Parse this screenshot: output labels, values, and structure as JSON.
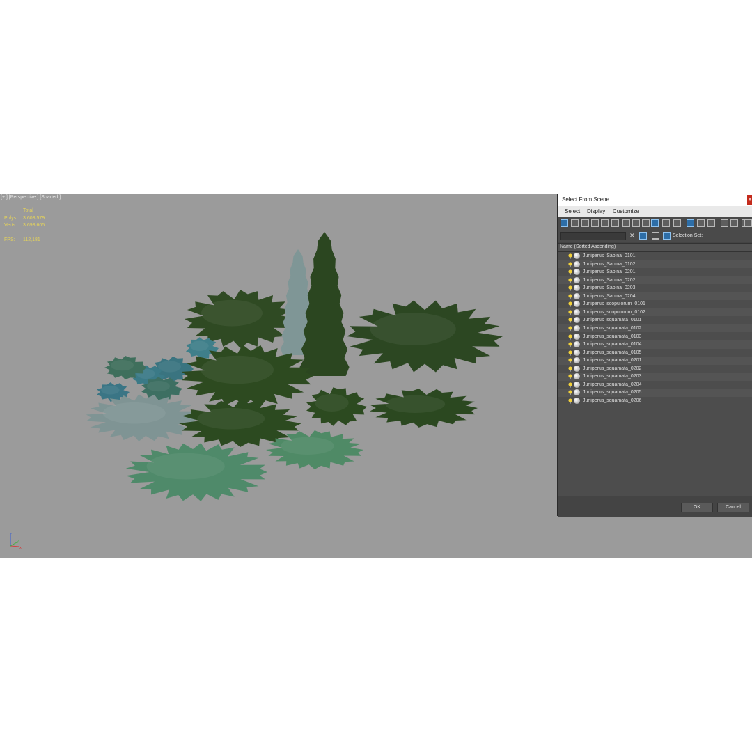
{
  "viewport": {
    "label": "[+ ] [Perspective ] [Shaded ]",
    "stats": {
      "header": "Total",
      "polys_label": "Polys:",
      "polys_value": "3 603 579",
      "verts_label": "Verts:",
      "verts_value": "3 693 605",
      "fps_label": "FPS:",
      "fps_value": "112,181"
    },
    "axis": {
      "z": "z",
      "x": "x",
      "y": "y"
    }
  },
  "dialog": {
    "title": "Select From Scene",
    "close_glyph": "×",
    "menu": [
      "Select",
      "Display",
      "Customize"
    ],
    "search_placeholder": "",
    "selection_set_label": "Selection Set:",
    "column_header": "Name (Sorted Ascending)",
    "items": [
      "Juniperus_Sabina_0101",
      "Juniperus_Sabina_0102",
      "Juniperus_Sabina_0201",
      "Juniperus_Sabina_0202",
      "Juniperus_Sabina_0203",
      "Juniperus_Sabina_0204",
      "Juniperus_scopulorum_0101",
      "Juniperus_scopulorum_0102",
      "Juniperus_squamata_0101",
      "Juniperus_squamata_0102",
      "Juniperus_squamata_0103",
      "Juniperus_squamata_0104",
      "Juniperus_squamata_0105",
      "Juniperus_squamata_0201",
      "Juniperus_squamata_0202",
      "Juniperus_squamata_0203",
      "Juniperus_squamata_0204",
      "Juniperus_squamata_0205",
      "Juniperus_squamata_0206"
    ],
    "ok_label": "OK",
    "cancel_label": "Cancel"
  },
  "colors": {
    "viewport_bg": "#9b9b9b",
    "stats_text": "#e5d35a",
    "dialog_bg": "#444444",
    "close_button": "#c42b1c",
    "dark_green": "#2f4a23",
    "light_green": "#4f8a6a",
    "blue_green": "#3f7f8a",
    "silver_green": "#7f9696"
  },
  "toolbar_icons": [
    "display-geometry-icon",
    "display-shapes-icon",
    "display-lights-icon",
    "display-cameras-icon",
    "display-helpers-icon",
    "display-spacewarps-icon",
    "display-groups-icon",
    "display-xrefs-icon",
    "display-bones-icon",
    "display-containers-icon",
    "display-frozen-icon",
    "display-hidden-icon",
    "display-all-icon",
    "display-none-icon",
    "display-invert-icon",
    "display-children-icon",
    "filter-icon",
    "filter-selected-icon",
    "columns-icon"
  ]
}
